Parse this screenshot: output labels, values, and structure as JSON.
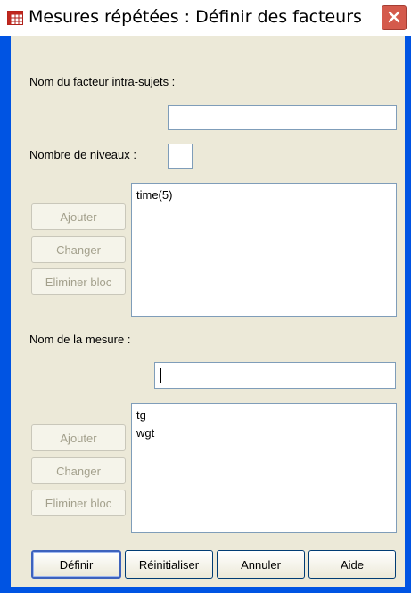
{
  "window": {
    "title": "Mesures répétées : Définir des facteurs"
  },
  "factor": {
    "name_label": "Nom du facteur intra-sujets :",
    "name_value": "",
    "levels_label": "Nombre de niveaux :",
    "levels_value": "",
    "list_items": [
      "time(5)"
    ],
    "buttons": {
      "add": "Ajouter",
      "change": "Changer",
      "remove": "Eliminer bloc"
    }
  },
  "measure": {
    "name_label": "Nom de la mesure :",
    "name_value": "",
    "list_items": [
      "tg",
      "wgt"
    ],
    "buttons": {
      "add": "Ajouter",
      "change": "Changer",
      "remove": "Eliminer bloc"
    }
  },
  "footer": {
    "define": "Définir",
    "reset": "Réinitialiser",
    "cancel": "Annuler",
    "help": "Aide"
  },
  "colors": {
    "frame": "#0054e3",
    "dialog_bg": "#ece9d8",
    "close_button": "#d45a4c"
  }
}
